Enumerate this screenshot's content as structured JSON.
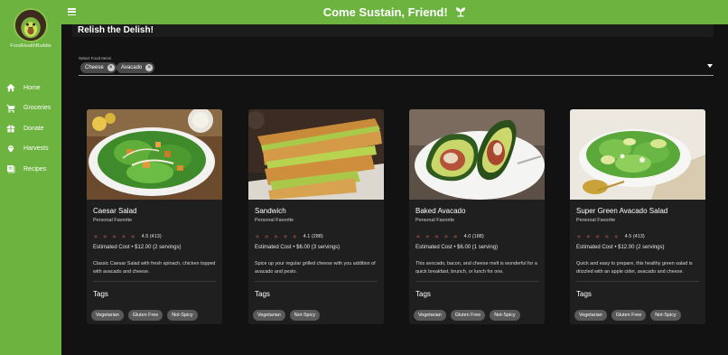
{
  "brand": {
    "name": "FoodHealthBuddie"
  },
  "header": {
    "title": "Come Sustain, Friend!",
    "menu_icon": "menu-icon",
    "title_icon": "sprout-icon"
  },
  "colors": {
    "primary": "#6db33f",
    "background": "#121212",
    "card": "#1f1f1f",
    "chip": "#4a4a4a",
    "star": "#7a3c3c"
  },
  "sidebar": {
    "items": [
      {
        "label": "Home",
        "icon": "home-icon"
      },
      {
        "label": "Groceries",
        "icon": "cart-icon"
      },
      {
        "label": "Donate",
        "icon": "gift-icon"
      },
      {
        "label": "Harvests",
        "icon": "harvest-icon"
      },
      {
        "label": "Recipes",
        "icon": "book-icon"
      }
    ]
  },
  "page": {
    "title": "Relish the Delish!"
  },
  "filter": {
    "label": "Select Food Items",
    "chips": [
      "Cheese",
      "Avacado"
    ]
  },
  "cards": [
    {
      "title": "Caesar Salad",
      "subtitle": "Personal Favorite",
      "stars": "★★★★★",
      "rating": "4.5 (413)",
      "cost": "Estimated Cost • $12.00 (2 servings)",
      "description": "Classic Caesar Salad with fresh spinach, chicken topped with avacado and cheese.",
      "tags_title": "Tags",
      "tags": [
        "Vegetarian",
        "Gluten Free",
        "Not-Spicy"
      ]
    },
    {
      "title": "Sandwich",
      "subtitle": "Personal Favorite",
      "stars": "★★★★★",
      "rating": "4.1 (288)",
      "cost": "Estimated Cost • $6.00 (3 servings)",
      "description": "Spice up your regular grilled cheese with you addition of avacado and pesto.",
      "tags_title": "Tags",
      "tags": [
        "Vegetarian",
        "Not-Spicy"
      ]
    },
    {
      "title": "Baked Avacado",
      "subtitle": "Personal Favorite",
      "stars": "★★★★★",
      "rating": "4.0 (188)",
      "cost": "Estimated Cost • $6.00 (1 serving)",
      "description": "This avocado, bacon, and cheese melt is wonderful for a quick breakfast, brunch, or lunch for one.",
      "tags_title": "Tags",
      "tags": [
        "Vegetarian",
        "Gluten Free",
        "Not-Spicy"
      ]
    },
    {
      "title": "Super Green Avacado Salad",
      "subtitle": "Personal Favorite",
      "stars": "★★★★★",
      "rating": "4.5 (413)",
      "cost": "Estimated Cost • $12.00 (2 servings)",
      "description": "Quick and easy to prepare, this healthy green salad is drizzled with an apple cider, avacado and cheese.",
      "tags_title": "Tags",
      "tags": [
        "Vegetarian",
        "Gluten Free",
        "Not-Spicy"
      ]
    }
  ]
}
